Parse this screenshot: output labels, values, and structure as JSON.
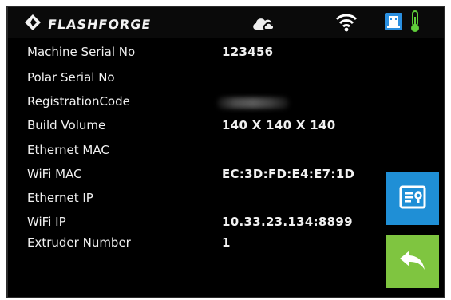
{
  "header": {
    "brand": "FLASHFORGE",
    "icons": [
      "flashforge-logo-icon",
      "cloud-icon",
      "wifi-icon",
      "usb-device-icon",
      "thermometer-icon"
    ],
    "colors": {
      "wifi": "#ffffff",
      "usb_badge": "#2a8fe0",
      "thermometer": "#5fcf3a"
    }
  },
  "info": {
    "rows": [
      {
        "label": "Machine Serial No",
        "value": "123456"
      },
      {
        "label": "Polar Serial No",
        "value": ""
      },
      {
        "label": "RegistrationCode",
        "value": ""
      },
      {
        "label": "Build Volume",
        "value": "140 X 140 X 140"
      },
      {
        "label": "Ethernet MAC",
        "value": ""
      },
      {
        "label": "WiFi MAC",
        "value": "EC:3D:FD:E4:E7:1D"
      },
      {
        "label": "Ethernet IP",
        "value": ""
      },
      {
        "label": "WiFi IP",
        "value": "10.33.23.134:8899"
      },
      {
        "label": "Extruder Number",
        "value": "1"
      }
    ]
  },
  "side_buttons": {
    "info_icon": "info-card-icon",
    "back_icon": "back-arrow-icon",
    "colors": {
      "info": "#1f8fd6",
      "back": "#7fc540"
    }
  }
}
